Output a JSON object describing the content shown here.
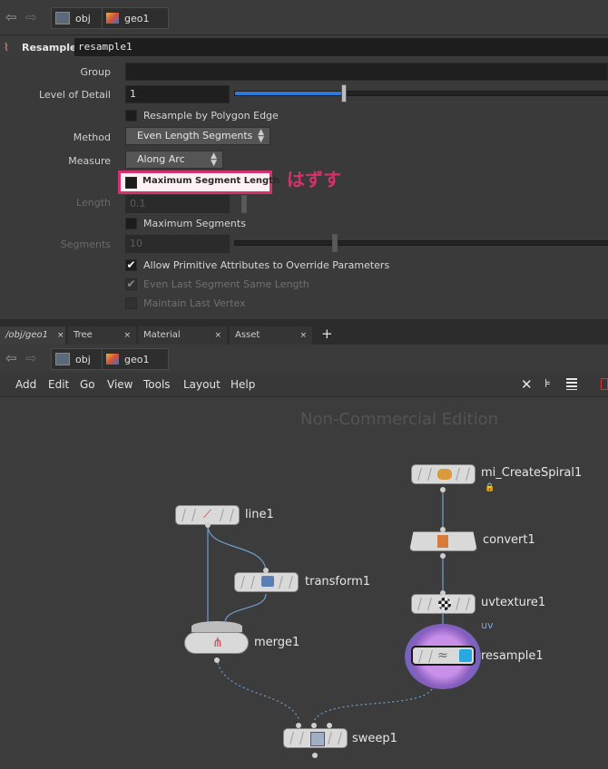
{
  "top_path": {
    "back": "⇦",
    "forward": "⇨",
    "crumb1": "obj",
    "crumb2": "geo1"
  },
  "node_header": {
    "type_label": "Resample",
    "name": "resample1"
  },
  "params": {
    "group_label": "Group",
    "group_value": "",
    "lod_label": "Level of Detail",
    "lod_value": "1",
    "lod_slider_fraction": 0.29,
    "polygon_edge_label": "Resample by Polygon Edge",
    "method_label": "Method",
    "method_value": "Even Length Segments",
    "measure_label": "Measure",
    "measure_value": "Along Arc",
    "max_seg_length_label": "Maximum Segment Length",
    "length_label": "Length",
    "length_value": "0.1",
    "max_segments_label": "Maximum Segments",
    "segments_label": "Segments",
    "segments_value": "10",
    "allow_prim_label": "Allow Primitive Attributes to Override Parameters",
    "even_last_label": "Even Last Segment Same Length",
    "maintain_last_label": "Maintain Last Vertex"
  },
  "annotation": {
    "text": "はずす",
    "color": "#d6316d"
  },
  "tabs": [
    {
      "label": "/obj/geo1",
      "close": "×"
    },
    {
      "label": "Tree View",
      "close": "×"
    },
    {
      "label": "Material Palette",
      "close": "×"
    },
    {
      "label": "Asset Browser",
      "close": "×"
    }
  ],
  "add_tab": "+",
  "net_path": {
    "crumb1": "obj",
    "crumb2": "geo1"
  },
  "menu": [
    "Add",
    "Edit",
    "Go",
    "View",
    "Tools",
    "Layout",
    "Help"
  ],
  "watermark": "Non-Commercial Edition",
  "nodes": {
    "line1": "line1",
    "transform1": "transform1",
    "merge1": "merge1",
    "sweep1": "sweep1",
    "spiral": "mi_CreateSpiral1",
    "convert1": "convert1",
    "uvtexture1": "uvtexture1",
    "resample1": "resample1",
    "uv_badge": "uv"
  },
  "colors": {
    "accent": "#2d7bd6",
    "highlight": "#d6316d",
    "selected_ring": "#8a5fc0"
  }
}
